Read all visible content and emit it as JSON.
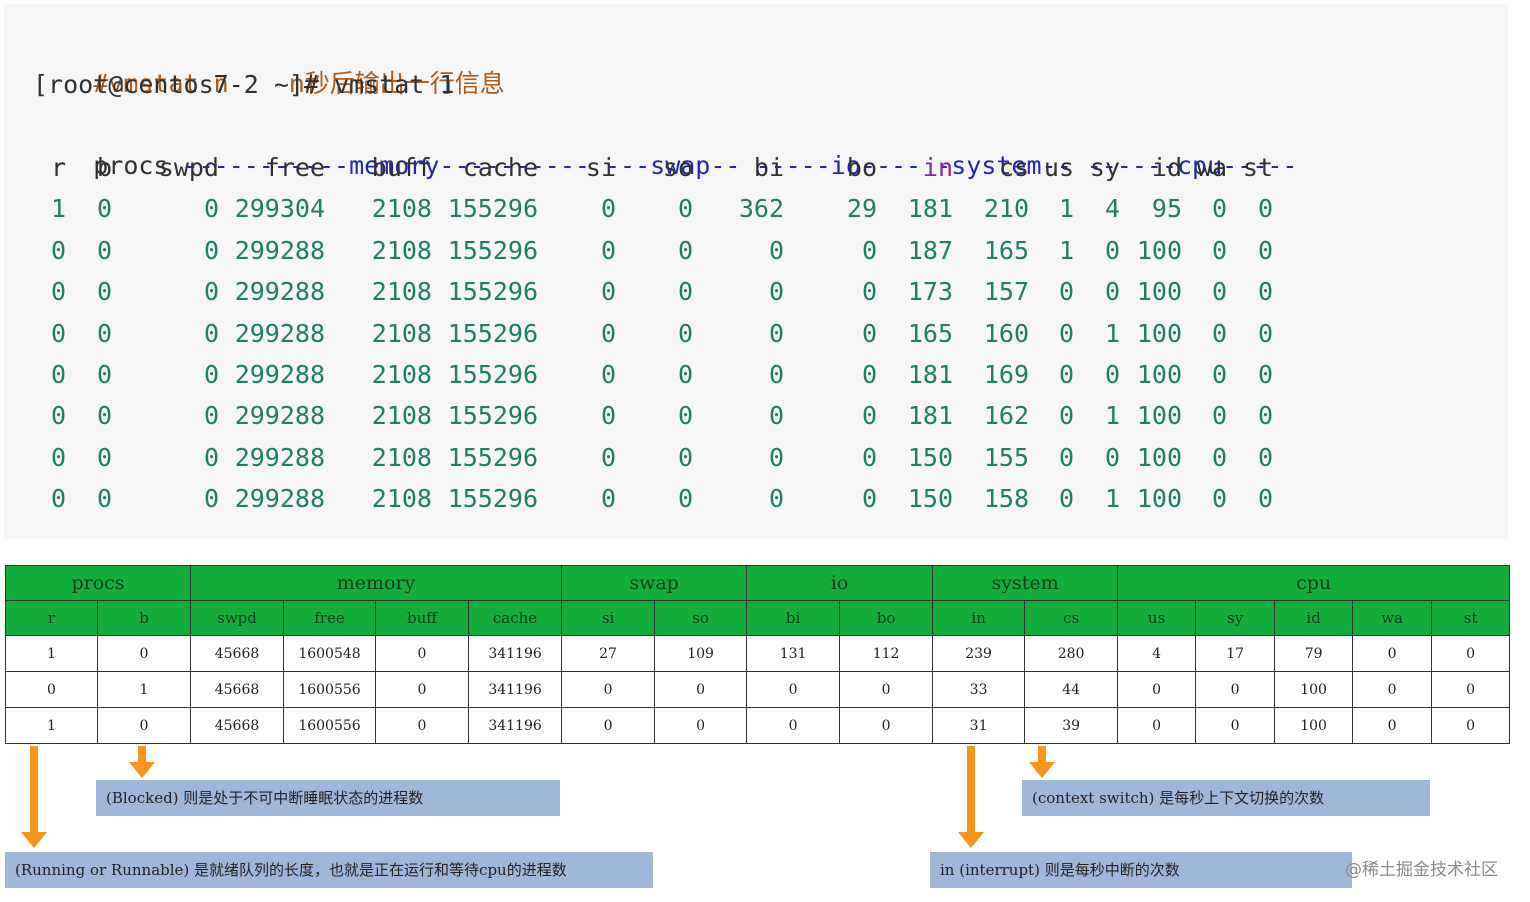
{
  "terminal": {
    "comment_cmd": "#vmstat n",
    "comment_text": "n秒后输出一行信息",
    "prompt": "[root@centos7-2 ~]# vmstat 1",
    "group_header": {
      "procs": "procs",
      "memory": "-----------memory----------",
      "swap": "---swap--",
      "io": "-----io----",
      "system": "-system--",
      "cpu": "------cpu-----"
    },
    "columns": [
      "r",
      "b",
      "swpd",
      "free",
      "buff",
      "cache",
      "si",
      "so",
      "bi",
      "bo",
      "in",
      "cs",
      "us",
      "sy",
      "id",
      "wa",
      "st"
    ],
    "rows": [
      [
        "1",
        "0",
        "0",
        "299304",
        "2108",
        "155296",
        "0",
        "0",
        "362",
        "29",
        "181",
        "210",
        "1",
        "4",
        "95",
        "0",
        "0"
      ],
      [
        "0",
        "0",
        "0",
        "299288",
        "2108",
        "155296",
        "0",
        "0",
        "0",
        "0",
        "187",
        "165",
        "1",
        "0",
        "100",
        "0",
        "0"
      ],
      [
        "0",
        "0",
        "0",
        "299288",
        "2108",
        "155296",
        "0",
        "0",
        "0",
        "0",
        "173",
        "157",
        "0",
        "0",
        "100",
        "0",
        "0"
      ],
      [
        "0",
        "0",
        "0",
        "299288",
        "2108",
        "155296",
        "0",
        "0",
        "0",
        "0",
        "165",
        "160",
        "0",
        "1",
        "100",
        "0",
        "0"
      ],
      [
        "0",
        "0",
        "0",
        "299288",
        "2108",
        "155296",
        "0",
        "0",
        "0",
        "0",
        "181",
        "169",
        "0",
        "0",
        "100",
        "0",
        "0"
      ],
      [
        "0",
        "0",
        "0",
        "299288",
        "2108",
        "155296",
        "0",
        "0",
        "0",
        "0",
        "181",
        "162",
        "0",
        "1",
        "100",
        "0",
        "0"
      ],
      [
        "0",
        "0",
        "0",
        "299288",
        "2108",
        "155296",
        "0",
        "0",
        "0",
        "0",
        "150",
        "155",
        "0",
        "0",
        "100",
        "0",
        "0"
      ],
      [
        "0",
        "0",
        "0",
        "299288",
        "2108",
        "155296",
        "0",
        "0",
        "0",
        "0",
        "150",
        "158",
        "0",
        "1",
        "100",
        "0",
        "0"
      ]
    ]
  },
  "table": {
    "groups": [
      {
        "label": "procs",
        "span": 2
      },
      {
        "label": "memory",
        "span": 4
      },
      {
        "label": "swap",
        "span": 2
      },
      {
        "label": "io",
        "span": 2
      },
      {
        "label": "system",
        "span": 2
      },
      {
        "label": "cpu",
        "span": 5
      }
    ],
    "columns": [
      "r",
      "b",
      "swpd",
      "free",
      "buff",
      "cache",
      "si",
      "so",
      "bi",
      "bo",
      "in",
      "cs",
      "us",
      "sy",
      "id",
      "wa",
      "st"
    ],
    "rows": [
      [
        "1",
        "0",
        "45668",
        "1600548",
        "0",
        "341196",
        "27",
        "109",
        "131",
        "112",
        "239",
        "280",
        "4",
        "17",
        "79",
        "0",
        "0"
      ],
      [
        "0",
        "1",
        "45668",
        "1600556",
        "0",
        "341196",
        "0",
        "0",
        "0",
        "0",
        "33",
        "44",
        "0",
        "0",
        "100",
        "0",
        "0"
      ],
      [
        "1",
        "0",
        "45668",
        "1600556",
        "0",
        "341196",
        "0",
        "0",
        "0",
        "0",
        "31",
        "39",
        "0",
        "0",
        "100",
        "0",
        "0"
      ]
    ]
  },
  "annotations": {
    "blocked": "(Blocked) 则是处于不可中断睡眠状态的进程数",
    "running": "(Running or Runnable) 是就绪队列的长度，也就是正在运行和等待cpu的进程数",
    "context_switch": "(context switch) 是每秒上下文切换的次数",
    "interrupt": "in (interrupt) 则是每秒中断的次数"
  },
  "watermark": "@稀土掘金技术社区",
  "colors": {
    "terminal_bg": "#f6f6f6",
    "comment": "#b25b17",
    "group_header": "#1f28b5",
    "highlight_column": "#8a1fa8",
    "numbers": "#1e7f63",
    "table_header_bg": "#13ad3c",
    "arrow": "#f7941d",
    "note_bg": "#9fb7d8"
  }
}
